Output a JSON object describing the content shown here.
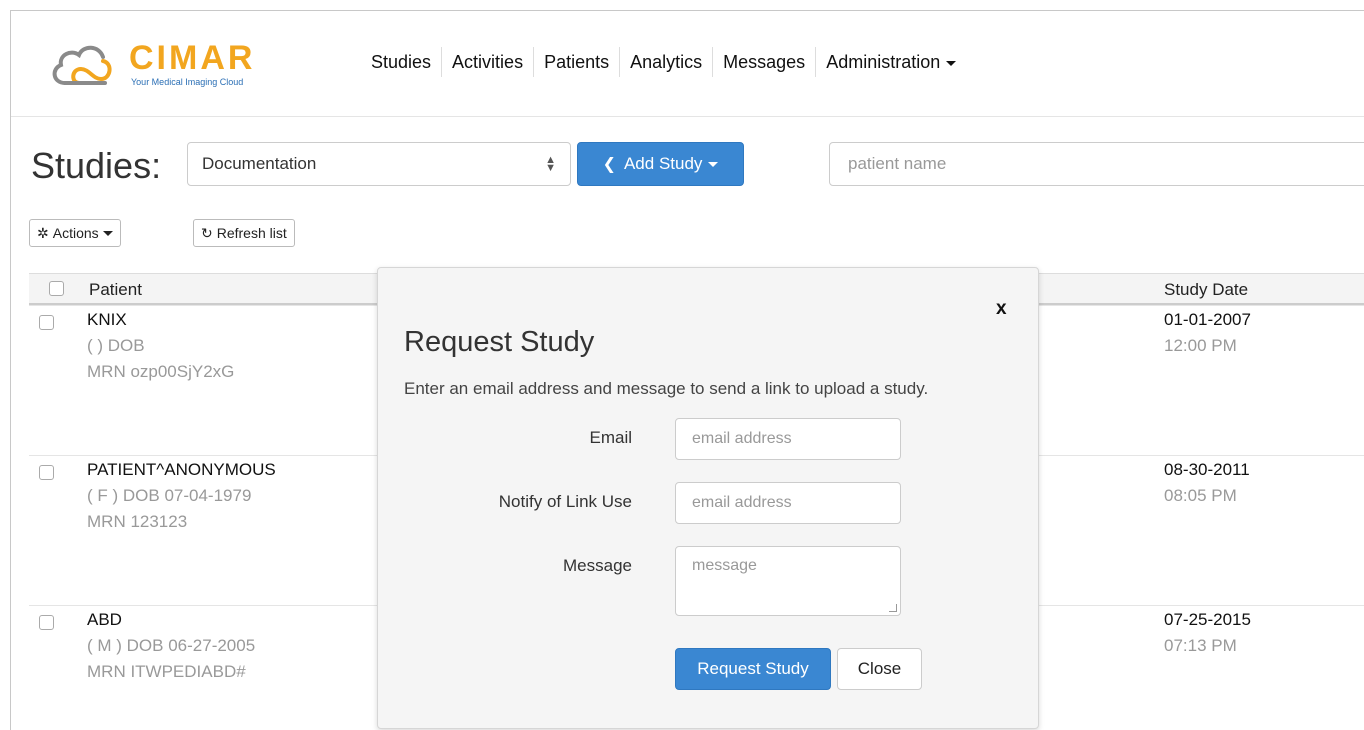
{
  "brand": {
    "name": "CIMAR",
    "tagline": "Your Medical Imaging Cloud",
    "orange": "#f2a61f",
    "gray": "#8a8a8a",
    "blue": "#2b6fb5"
  },
  "nav": {
    "items": [
      "Studies",
      "Activities",
      "Patients",
      "Analytics",
      "Messages",
      "Administration"
    ]
  },
  "toolbar": {
    "title": "Studies:",
    "folder_select": "Documentation",
    "add_study_label": "Add Study",
    "search_placeholder": "patient name",
    "actions_label": "Actions",
    "refresh_label": "Refresh list"
  },
  "table": {
    "headers": {
      "patient": "Patient",
      "study_date": "Study Date"
    },
    "rows": [
      {
        "name": "KNIX",
        "dob": "( ) DOB",
        "mrn": "MRN ozp00SjY2xG",
        "date": "01-01-2007",
        "time": "12:00 PM"
      },
      {
        "name": "PATIENT^ANONYMOUS",
        "dob": "( F ) DOB 07-04-1979",
        "mrn": "MRN 123123",
        "date": "08-30-2011",
        "time": "08:05 PM"
      },
      {
        "name": "ABD",
        "dob": "( M ) DOB 06-27-2005",
        "mrn": "MRN ITWPEDIABD#",
        "date": "07-25-2015",
        "time": "07:13 PM"
      }
    ]
  },
  "modal": {
    "close_x": "x",
    "title": "Request Study",
    "description": "Enter an email address and message to send a link to upload a study.",
    "email_label": "Email",
    "email_placeholder": "email address",
    "notify_label": "Notify of Link Use",
    "notify_placeholder": "email address",
    "message_label": "Message",
    "message_placeholder": "message",
    "submit_label": "Request Study",
    "close_label": "Close"
  },
  "colors": {
    "primary": "#3a87d2"
  },
  "icons": {
    "actions": "gear-icon",
    "refresh": "refresh-icon",
    "add": "chevron-left-icon"
  }
}
